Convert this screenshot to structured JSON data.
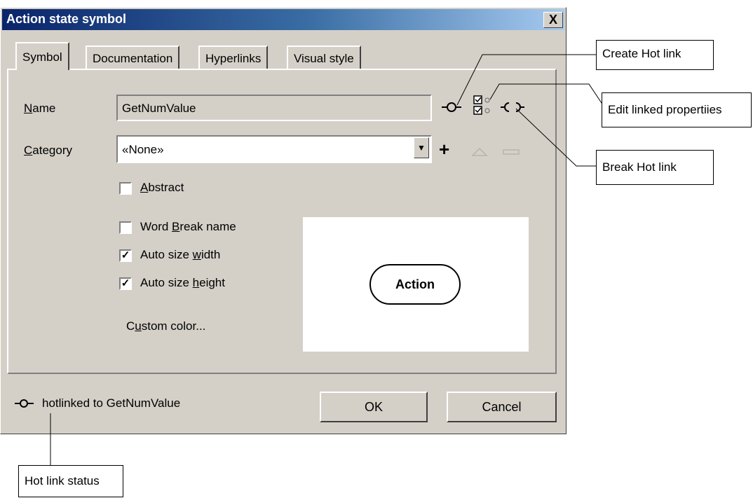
{
  "window": {
    "title": "Action state symbol",
    "close_label": "X"
  },
  "tabs": [
    {
      "label": "Symbol",
      "active": true
    },
    {
      "label": "Documentation",
      "active": false
    },
    {
      "label": "Hyperlinks",
      "active": false
    },
    {
      "label": "Visual style",
      "active": false
    }
  ],
  "form": {
    "name_label": "Name",
    "name_value": "GetNumValue",
    "category_label": "Category",
    "category_value": "«None»",
    "abstract_label": "Abstract",
    "abstract_checked": false,
    "word_break_label": "Word Break name",
    "word_break_checked": false,
    "auto_width_label": "Auto size width",
    "auto_width_checked": true,
    "auto_height_label": "Auto size height",
    "auto_height_checked": true,
    "custom_color_label": "Custom color..."
  },
  "preview": {
    "symbol_text": "Action"
  },
  "status": {
    "text": "hotlinked to GetNumValue"
  },
  "buttons": {
    "ok": "OK",
    "cancel": "Cancel"
  },
  "callouts": {
    "create_hot_link": "Create Hot link",
    "edit_linked": "Edit linked propertiies",
    "break_hot_link": "Break Hot link",
    "hot_link_status": "Hot link status"
  },
  "colors": {
    "titlebar_start": "#0a246a",
    "titlebar_end": "#a6caf0",
    "face": "#d4d0c8"
  }
}
